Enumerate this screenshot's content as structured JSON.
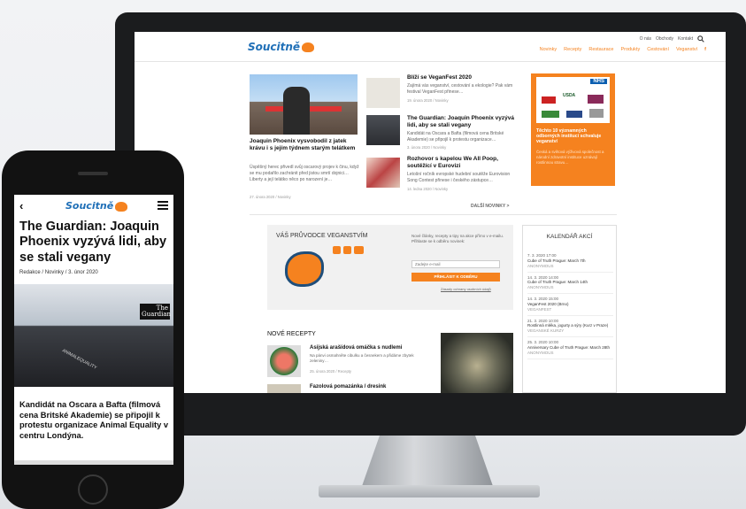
{
  "brand": {
    "logo_text": "Soucitně",
    "accent": "#f5821f",
    "blue": "#1f6fb7"
  },
  "desktop": {
    "top_links": [
      "O nás",
      "Obchody",
      "Kontakt"
    ],
    "nav": [
      "Novinky",
      "Recepty",
      "Restaurace",
      "Produkty",
      "Cestování",
      "Veganství"
    ],
    "lead": {
      "title": "Joaquin Phoenix vysvobodil z jatek krávu i s jejím týdnem starým telátkem",
      "excerpt": "Úspěšný herec přivedl svůj oscarový projev k činu, když se mu podařilo zachránit před jistou smrtí dojnici… Liberty a její telátko něco po narození je…",
      "meta": "27. února 2020 / Novinky"
    },
    "news": [
      {
        "title": "Blíží se VeganFest 2020",
        "excerpt": "Zajímá vás veganství, cestování a ekologie? Pak vám festival VeganFest přinese…",
        "meta": "19. února 2020 / Novinky"
      },
      {
        "title": "The Guardian: Joaquin Phoenix vyzývá lidi, aby se stali vegany",
        "excerpt": "Kandidát na Oscara a Bafta (filmová cena Britské Akademie) se připojil k protestu organizace…",
        "meta": "3. února 2020 / Novinky"
      },
      {
        "title": "Rozhovor s kapelou We All Poop, soutěžící v Eurovizi",
        "excerpt": "Letošní ročník evropské hudební soutěže Eurovision Song Contest přinese i českého zástupce…",
        "meta": "14. ledna 2020 / Novinky"
      }
    ],
    "promo": {
      "title": "Těchto 10 významných odborných institucí schvaluje veganství",
      "excerpt": "Česká a světová výživová společnost a národní zdravotní instituce uznávají rostlinnou stravu…",
      "logo_nhs": "NHS",
      "logo_usda": "USDA"
    },
    "more_news": "DALŠÍ NOVINKY >",
    "guide": {
      "title": "VÁŠ PRŮVODCE VEGANSTVÍM",
      "text": "Nové články, recepty a tipy na akce přímo v e-mailu. Přihlaste se k odběru novinek:",
      "email_placeholder": "Zadejte e-mail",
      "button": "PŘIHLÁSIT K ODBĚRU",
      "privacy": "Zásady ochrany osobních údajů"
    },
    "calendar": {
      "title": "KALENDÁŘ AKCÍ",
      "events": [
        {
          "date": "7. 3. 2020 17:00",
          "name": "Cube of Truth Prague: March 7th",
          "org": "ANONYMOUS"
        },
        {
          "date": "14. 3. 2020 14:00",
          "name": "Cube of Truth Prague: March 14th",
          "org": "ANONYMOUS"
        },
        {
          "date": "14. 3. 2020 15:00",
          "name": "VeganFest 2020 (Brno)",
          "org": "VEGANFEST"
        },
        {
          "date": "21. 3. 2020 10:00",
          "name": "Rostlinná mléka, jogurty a sýry (Kurz v Praze)",
          "org": "VEGANSKÉ KURZY"
        },
        {
          "date": "25. 3. 2020 10:00",
          "name": "Anniversary Cube of Truth Prague: March 28th",
          "org": "ANONYMOUS"
        }
      ]
    },
    "recipes": {
      "title": "NOVÉ RECEPTY",
      "items": [
        {
          "title": "Asijská arašídová omáčka s nudlemi",
          "excerpt": "Na pánvi osmahněte cibulku a česnekem a přidáme zbytek zeleniny…",
          "meta": "25. února 2020 / Recepty"
        },
        {
          "title": "Fazolová pomazánka / dresink",
          "excerpt": "",
          "meta": ""
        }
      ]
    }
  },
  "mobile": {
    "article_title": "The Guardian: Joaquin Phoenix vyzývá lidi, aby se stali vegany",
    "meta_author": "Redakce",
    "meta_category": "Novinky",
    "meta_date": "3. únor 2020",
    "image_caption": "The Guardian",
    "shirt_text": "ANIMALEQUALITY",
    "lede": "Kandidát na Oscara a Bafta (filmová cena Britské Akademie) se připojil k protestu organizace Animal Equality v centru Londýna."
  }
}
